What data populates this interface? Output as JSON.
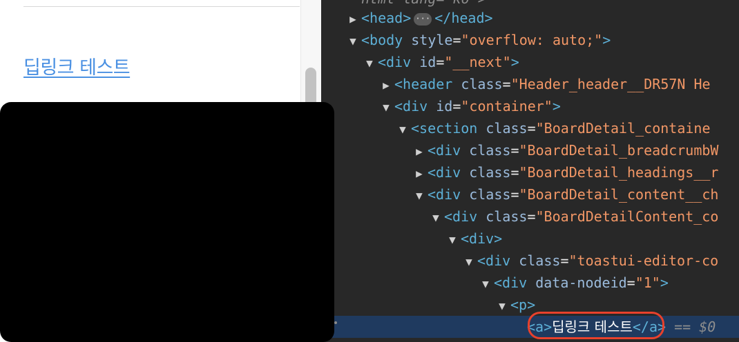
{
  "page": {
    "link_text": "딥링크 테스트"
  },
  "devtools": {
    "lines": [
      {
        "id": "html",
        "tri": "",
        "parts": [
          [
            "dim",
            "html lang=\"ko\">"
          ]
        ]
      },
      {
        "id": "head",
        "tri": "▶",
        "parts": [
          [
            "tag",
            "<head>"
          ],
          [
            "pill",
            "···"
          ],
          [
            "tag",
            "</head>"
          ]
        ]
      },
      {
        "id": "body",
        "tri": "▼",
        "parts": [
          [
            "tag",
            "<body "
          ],
          [
            "attr",
            "style"
          ],
          [
            "eq",
            "="
          ],
          [
            "val",
            "\"overflow: auto;\""
          ],
          [
            "tag",
            ">"
          ]
        ]
      },
      {
        "id": "next",
        "tri": "▼",
        "parts": [
          [
            "tag",
            "<div "
          ],
          [
            "attr",
            "id"
          ],
          [
            "eq",
            "="
          ],
          [
            "val",
            "\"__next\""
          ],
          [
            "tag",
            ">"
          ]
        ]
      },
      {
        "id": "header",
        "tri": "▶",
        "parts": [
          [
            "tag",
            "<header "
          ],
          [
            "attr",
            "class"
          ],
          [
            "eq",
            "="
          ],
          [
            "val",
            "\"Header_header__DR57N He"
          ]
        ]
      },
      {
        "id": "container",
        "tri": "▼",
        "parts": [
          [
            "tag",
            "<div "
          ],
          [
            "attr",
            "id"
          ],
          [
            "eq",
            "="
          ],
          [
            "val",
            "\"container\""
          ],
          [
            "tag",
            ">"
          ]
        ]
      },
      {
        "id": "section",
        "tri": "▼",
        "parts": [
          [
            "tag",
            "<section "
          ],
          [
            "attr",
            "class"
          ],
          [
            "eq",
            "="
          ],
          [
            "val",
            "\"BoardDetail_containe"
          ]
        ]
      },
      {
        "id": "breadcrumb",
        "tri": "▶",
        "parts": [
          [
            "tag",
            "<div "
          ],
          [
            "attr",
            "class"
          ],
          [
            "eq",
            "="
          ],
          [
            "val",
            "\"BoardDetail_breadcrumbW"
          ]
        ]
      },
      {
        "id": "headings",
        "tri": "▶",
        "parts": [
          [
            "tag",
            "<div "
          ],
          [
            "attr",
            "class"
          ],
          [
            "eq",
            "="
          ],
          [
            "val",
            "\"BoardDetail_headings__r"
          ]
        ]
      },
      {
        "id": "content",
        "tri": "▼",
        "parts": [
          [
            "tag",
            "<div "
          ],
          [
            "attr",
            "class"
          ],
          [
            "eq",
            "="
          ],
          [
            "val",
            "\"BoardDetail_content__ch"
          ]
        ]
      },
      {
        "id": "bdcontent",
        "tri": "▼",
        "parts": [
          [
            "tag",
            "<div "
          ],
          [
            "attr",
            "class"
          ],
          [
            "eq",
            "="
          ],
          [
            "val",
            "\"BoardDetailContent_co"
          ]
        ]
      },
      {
        "id": "plaindiv",
        "tri": "▼",
        "parts": [
          [
            "tag",
            "<div>"
          ]
        ]
      },
      {
        "id": "toastui",
        "tri": "▼",
        "parts": [
          [
            "tag",
            "<div "
          ],
          [
            "attr",
            "class"
          ],
          [
            "eq",
            "="
          ],
          [
            "val",
            "\"toastui-editor-co"
          ]
        ]
      },
      {
        "id": "nodeid",
        "tri": "▼",
        "parts": [
          [
            "tag",
            "<div "
          ],
          [
            "attr",
            "data-nodeid"
          ],
          [
            "eq",
            "="
          ],
          [
            "val",
            "\"1\""
          ],
          [
            "tag",
            ">"
          ]
        ]
      },
      {
        "id": "p",
        "tri": "▼",
        "parts": [
          [
            "tag",
            "<p>"
          ]
        ]
      },
      {
        "id": "anchor",
        "tri": "",
        "parts": [
          [
            "tag",
            "<a>"
          ],
          [
            "txt",
            "딥링크 테스트"
          ],
          [
            "tag",
            "</a>"
          ],
          [
            "dim",
            " == $0"
          ]
        ]
      }
    ]
  }
}
